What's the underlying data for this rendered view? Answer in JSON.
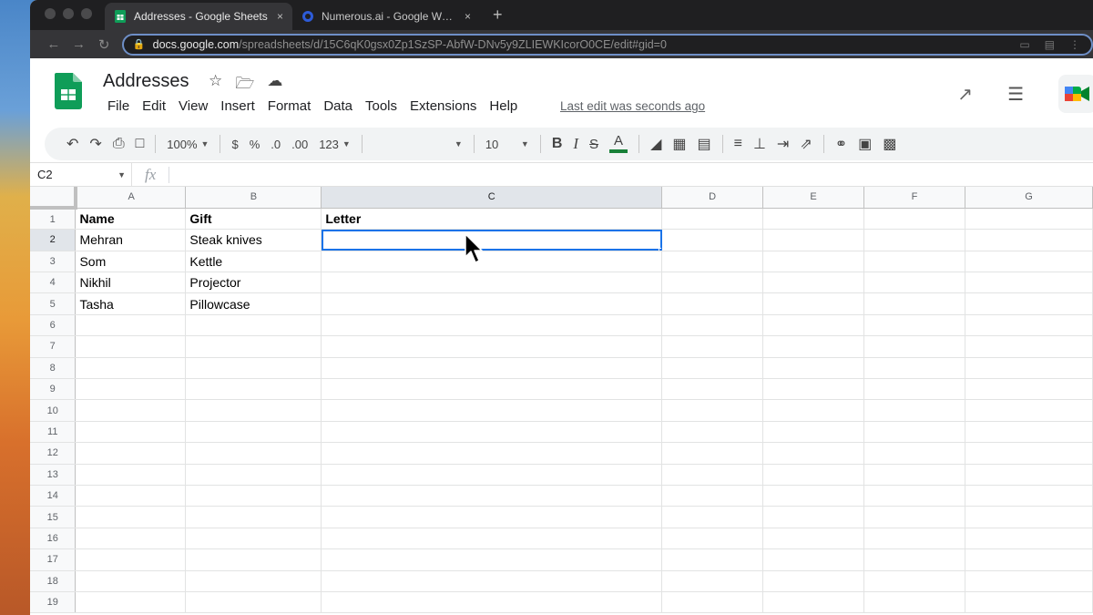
{
  "browser": {
    "tabs": [
      {
        "title": "Addresses - Google Sheets",
        "active": true,
        "favicon": "sheets-icon",
        "close": "×"
      },
      {
        "title": "Numerous.ai - Google Worksp",
        "active": false,
        "favicon": "numerous-icon",
        "close": "×"
      }
    ],
    "new_tab": "+",
    "url_host": "docs.google.com",
    "url_path": "/spreadsheets/d/15C6qK0gsx0Zp1SzSP-AbfW-DNv5y9ZLIEWKIcorO0CE/edit#gid=0"
  },
  "app": {
    "title": "Addresses",
    "menu": [
      "File",
      "Edit",
      "View",
      "Insert",
      "Format",
      "Data",
      "Tools",
      "Extensions",
      "Help"
    ],
    "last_edit": "Last edit was seconds ago"
  },
  "toolbar": {
    "zoom": "100%",
    "currency": "$",
    "percent": "%",
    "dec_decrease": ".0",
    "dec_increase": ".00",
    "more_formats": "123",
    "font_size": "10",
    "bold": "B",
    "italic": "I",
    "strike": "S",
    "text_color": "A",
    "text_color_value": "#188038"
  },
  "formula_bar": {
    "cell_ref": "C2",
    "fx": "fx",
    "value": ""
  },
  "sheet": {
    "columns": [
      "A",
      "B",
      "C",
      "D",
      "E",
      "F",
      "G"
    ],
    "row_numbers": [
      "1",
      "2",
      "3",
      "4",
      "5",
      "6",
      "7",
      "8",
      "9",
      "10",
      "11",
      "12",
      "13",
      "14",
      "15",
      "16",
      "17",
      "18",
      "19"
    ],
    "rows": [
      [
        "Name",
        "Gift",
        "Letter"
      ],
      [
        "Mehran",
        "Steak knives",
        ""
      ],
      [
        "Som",
        "Kettle",
        ""
      ],
      [
        "Nikhil",
        "Projector",
        ""
      ],
      [
        "Tasha",
        "Pillowcase",
        ""
      ]
    ],
    "selected_cell": "C2",
    "selection_color": "#1a73e8"
  }
}
